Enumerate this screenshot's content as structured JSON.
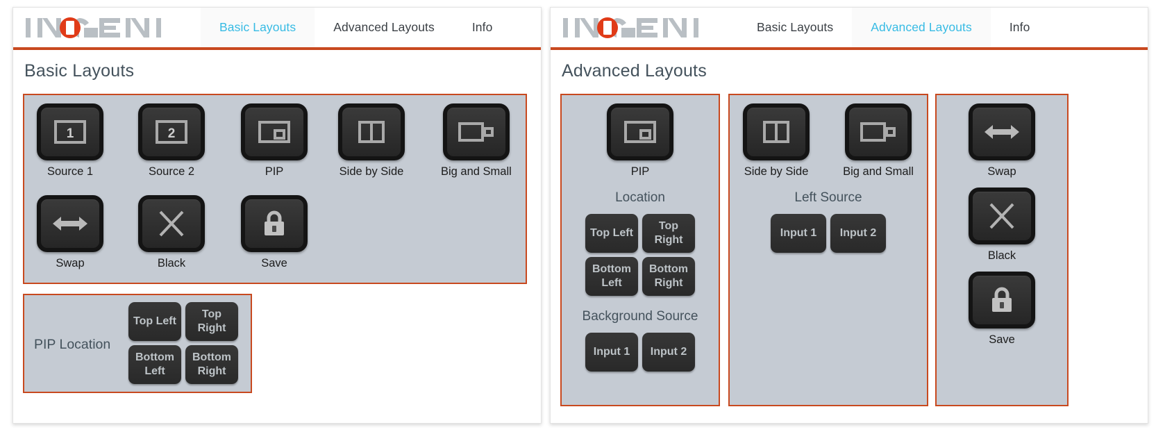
{
  "brand": {
    "name": "INOGENI",
    "accent_color": "#e03b18",
    "letters_color": "#b9bfc4"
  },
  "theme": {
    "accent_rule": "#c8491f",
    "active_tab_color": "#37bbe4",
    "group_bg": "#c5cbd3",
    "group_border": "#c8491f",
    "button_face": "#2f2f2f",
    "button_edge": "#141414",
    "button_text": "#bdc3c7",
    "label_text": "#44525c"
  },
  "windows": [
    {
      "id": "basic",
      "tabs": [
        {
          "label": "Basic Layouts",
          "active": true
        },
        {
          "label": "Advanced Layouts",
          "active": false
        },
        {
          "label": "Info",
          "active": false
        }
      ],
      "page_title": "Basic Layouts",
      "layout_buttons_row1": [
        {
          "label": "Source 1",
          "icon": "source-1-icon"
        },
        {
          "label": "Source 2",
          "icon": "source-2-icon"
        },
        {
          "label": "PIP",
          "icon": "pip-icon"
        },
        {
          "label": "Side by Side",
          "icon": "side-by-side-icon"
        },
        {
          "label": "Big and Small",
          "icon": "big-and-small-icon"
        }
      ],
      "layout_buttons_row2": [
        {
          "label": "Swap",
          "icon": "swap-arrows-icon"
        },
        {
          "label": "Black",
          "icon": "x-icon"
        },
        {
          "label": "Save",
          "icon": "lock-icon"
        }
      ],
      "pip_location": {
        "label": "PIP Location",
        "options": [
          "Top Left",
          "Top Right",
          "Bottom Left",
          "Bottom Right"
        ]
      }
    },
    {
      "id": "advanced",
      "tabs": [
        {
          "label": "Basic Layouts",
          "active": false
        },
        {
          "label": "Advanced Layouts",
          "active": true
        },
        {
          "label": "Info",
          "active": false
        }
      ],
      "page_title": "Advanced Layouts",
      "column_pip": {
        "button": {
          "label": "PIP",
          "icon": "pip-icon"
        },
        "location_label": "Location",
        "location_options": [
          "Top Left",
          "Top Right",
          "Bottom Left",
          "Bottom Right"
        ],
        "background_label": "Background Source",
        "background_options": [
          "Input 1",
          "Input 2"
        ]
      },
      "column_split": {
        "buttons": [
          {
            "label": "Side by Side",
            "icon": "side-by-side-icon"
          },
          {
            "label": "Big and Small",
            "icon": "big-and-small-icon"
          }
        ],
        "left_source_label": "Left Source",
        "left_source_options": [
          "Input 1",
          "Input 2"
        ]
      },
      "column_actions": {
        "buttons": [
          {
            "label": "Swap",
            "icon": "swap-arrows-icon"
          },
          {
            "label": "Black",
            "icon": "x-icon"
          },
          {
            "label": "Save",
            "icon": "lock-icon"
          }
        ]
      }
    }
  ]
}
